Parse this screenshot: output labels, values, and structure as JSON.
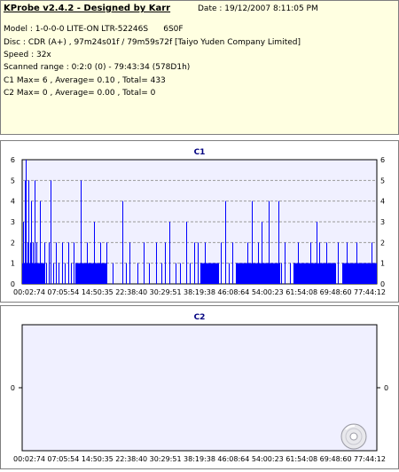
{
  "header": {
    "title": "KProbe v2.4.2 - Designed by Karr",
    "date": "Date : 19/12/2007 8:11:05 PM",
    "lines": [
      "Model : 1-0-0-0 LITE-ON LTR-52246S      6S0F",
      "Disc : CDR (A+) , 97m24s01f / 79m59s72f [Taiyo Yuden Company Limited]",
      "Speed : 32x",
      "Scanned range : 0:2:0 (0) - 79:43:34 (578D1h)",
      "C1 Max= 6 , Average= 0.10 , Total= 433",
      "C2 Max= 0 , Average= 0.00 , Total= 0"
    ]
  },
  "chart_data": [
    {
      "type": "bar",
      "title": "C1",
      "ylim": [
        0,
        6
      ],
      "yticks": [
        "0",
        "1",
        "2",
        "3",
        "4",
        "5",
        "6"
      ],
      "xticks": [
        "00:02:74",
        "07:05:54",
        "14:50:35",
        "22:38:40",
        "30:29:51",
        "38:19:38",
        "46:08:64",
        "54:00:23",
        "61:54:08",
        "69:48:60",
        "77:44:12"
      ],
      "x_range_minutes": [
        0.03,
        79.72
      ],
      "grid": true,
      "color": "#0000ff",
      "spikes": [
        {
          "x": 0.3,
          "y": 3
        },
        {
          "x": 0.6,
          "y": 5
        },
        {
          "x": 0.9,
          "y": 6
        },
        {
          "x": 1.2,
          "y": 2
        },
        {
          "x": 1.5,
          "y": 5
        },
        {
          "x": 1.8,
          "y": 2
        },
        {
          "x": 2.1,
          "y": 4
        },
        {
          "x": 2.5,
          "y": 2
        },
        {
          "x": 2.9,
          "y": 5
        },
        {
          "x": 3.3,
          "y": 2
        },
        {
          "x": 3.7,
          "y": 1
        },
        {
          "x": 4.1,
          "y": 4
        },
        {
          "x": 4.6,
          "y": 1
        },
        {
          "x": 5.0,
          "y": 2
        },
        {
          "x": 5.5,
          "y": 1
        },
        {
          "x": 6.0,
          "y": 2
        },
        {
          "x": 6.5,
          "y": 5
        },
        {
          "x": 7.0,
          "y": 1
        },
        {
          "x": 7.6,
          "y": 2
        },
        {
          "x": 8.2,
          "y": 1
        },
        {
          "x": 9.0,
          "y": 2
        },
        {
          "x": 9.6,
          "y": 1
        },
        {
          "x": 10.4,
          "y": 2
        },
        {
          "x": 11.0,
          "y": 1
        },
        {
          "x": 11.6,
          "y": 2
        },
        {
          "x": 12.6,
          "y": 1
        },
        {
          "x": 13.2,
          "y": 5
        },
        {
          "x": 13.8,
          "y": 1
        },
        {
          "x": 14.6,
          "y": 2
        },
        {
          "x": 15.2,
          "y": 1
        },
        {
          "x": 16.1,
          "y": 3
        },
        {
          "x": 16.8,
          "y": 1
        },
        {
          "x": 17.5,
          "y": 2
        },
        {
          "x": 18.2,
          "y": 1
        },
        {
          "x": 19.0,
          "y": 2
        },
        {
          "x": 20.4,
          "y": 1
        },
        {
          "x": 22.6,
          "y": 4
        },
        {
          "x": 23.4,
          "y": 1
        },
        {
          "x": 24.2,
          "y": 2
        },
        {
          "x": 26.0,
          "y": 1
        },
        {
          "x": 27.4,
          "y": 2
        },
        {
          "x": 28.6,
          "y": 1
        },
        {
          "x": 30.2,
          "y": 2
        },
        {
          "x": 31.3,
          "y": 1
        },
        {
          "x": 32.2,
          "y": 2
        },
        {
          "x": 33.2,
          "y": 3
        },
        {
          "x": 34.4,
          "y": 1
        },
        {
          "x": 35.5,
          "y": 1
        },
        {
          "x": 36.8,
          "y": 3
        },
        {
          "x": 37.6,
          "y": 1
        },
        {
          "x": 38.6,
          "y": 2
        },
        {
          "x": 39.4,
          "y": 2
        },
        {
          "x": 40.2,
          "y": 1
        },
        {
          "x": 41.0,
          "y": 2
        },
        {
          "x": 42.0,
          "y": 1
        },
        {
          "x": 43.0,
          "y": 1
        },
        {
          "x": 44.6,
          "y": 2
        },
        {
          "x": 45.7,
          "y": 4
        },
        {
          "x": 46.4,
          "y": 1
        },
        {
          "x": 47.2,
          "y": 2
        },
        {
          "x": 48.4,
          "y": 1
        },
        {
          "x": 49.5,
          "y": 1
        },
        {
          "x": 50.7,
          "y": 2
        },
        {
          "x": 51.7,
          "y": 4
        },
        {
          "x": 52.2,
          "y": 1
        },
        {
          "x": 53.0,
          "y": 2
        },
        {
          "x": 53.8,
          "y": 3
        },
        {
          "x": 54.6,
          "y": 1
        },
        {
          "x": 55.5,
          "y": 4
        },
        {
          "x": 56.2,
          "y": 1
        },
        {
          "x": 57.0,
          "y": 1
        },
        {
          "x": 57.6,
          "y": 4
        },
        {
          "x": 58.2,
          "y": 1
        },
        {
          "x": 59.0,
          "y": 2
        },
        {
          "x": 60.2,
          "y": 1
        },
        {
          "x": 61.2,
          "y": 1
        },
        {
          "x": 62.0,
          "y": 2
        },
        {
          "x": 63.0,
          "y": 1
        },
        {
          "x": 64.0,
          "y": 1
        },
        {
          "x": 64.8,
          "y": 2
        },
        {
          "x": 65.4,
          "y": 1
        },
        {
          "x": 66.2,
          "y": 3
        },
        {
          "x": 66.8,
          "y": 2
        },
        {
          "x": 67.6,
          "y": 1
        },
        {
          "x": 68.4,
          "y": 2
        },
        {
          "x": 69.4,
          "y": 1
        },
        {
          "x": 70.2,
          "y": 1
        },
        {
          "x": 71.0,
          "y": 2
        },
        {
          "x": 72.0,
          "y": 1
        },
        {
          "x": 73.0,
          "y": 2
        },
        {
          "x": 74.4,
          "y": 1
        },
        {
          "x": 75.2,
          "y": 2
        },
        {
          "x": 76.4,
          "y": 1
        },
        {
          "x": 77.6,
          "y": 1
        },
        {
          "x": 78.6,
          "y": 2
        },
        {
          "x": 79.4,
          "y": 1
        }
      ],
      "baseline_dense_ranges": [
        [
          0.1,
          5.0
        ],
        [
          12.0,
          19.0
        ],
        [
          40.0,
          44.0
        ],
        [
          48.0,
          58.0
        ],
        [
          61.0,
          70.5
        ],
        [
          72.0,
          79.6
        ]
      ]
    },
    {
      "type": "bar",
      "title": "C2",
      "ylim": [
        -1,
        1
      ],
      "yticks": [
        "0"
      ],
      "xticks": [
        "00:02:74",
        "07:05:54",
        "14:50:35",
        "22:38:40",
        "30:29:51",
        "38:19:38",
        "46:08:64",
        "54:00:23",
        "61:54:08",
        "69:48:60",
        "77:44:12"
      ],
      "x_range_minutes": [
        0.03,
        79.72
      ],
      "values": [],
      "grid": false,
      "color": "#0000ff"
    }
  ],
  "icons": {
    "disc": "cd-disc-icon"
  }
}
